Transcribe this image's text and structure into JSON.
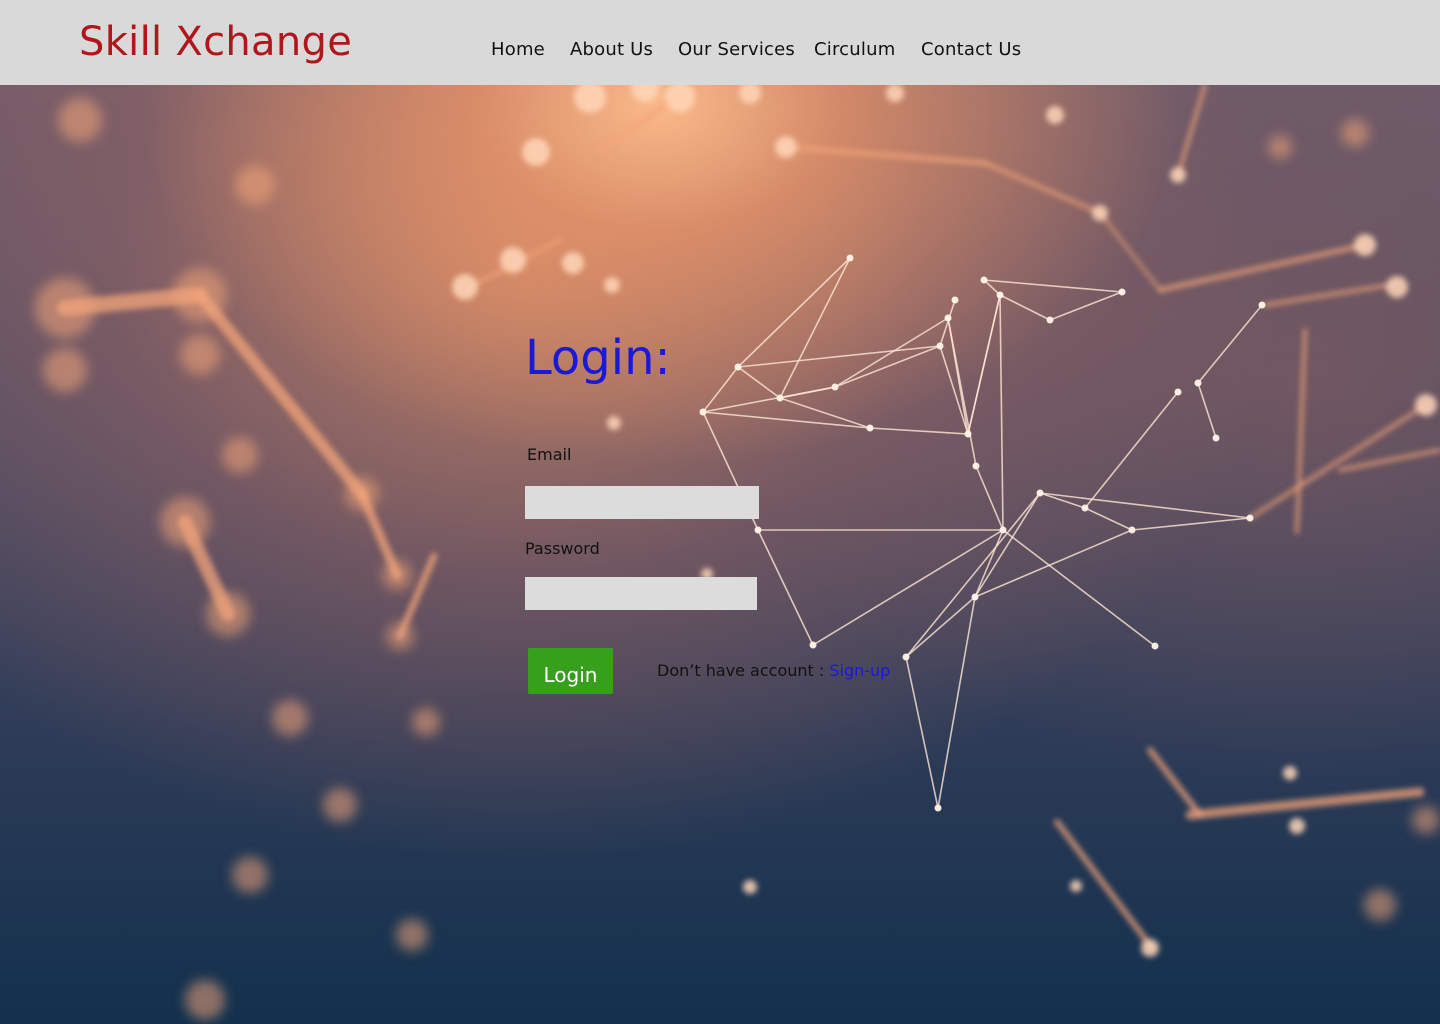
{
  "header": {
    "brand": "Skill Xchange",
    "nav": [
      "Home",
      "About Us",
      "Our Services",
      "Circulum",
      "Contact Us"
    ]
  },
  "login": {
    "title": "Login:",
    "email_label": "Email",
    "email_value": "",
    "password_label": "Password",
    "password_value": "",
    "button_label": "Login",
    "signup_prompt": "Don’t have account : ",
    "signup_link": "Sign-up"
  },
  "colors": {
    "header_bg": "#d9d9d9",
    "brand": "#b0171c",
    "title": "#1a1ad6",
    "button": "#36a01c",
    "link": "#1a1ad6"
  }
}
